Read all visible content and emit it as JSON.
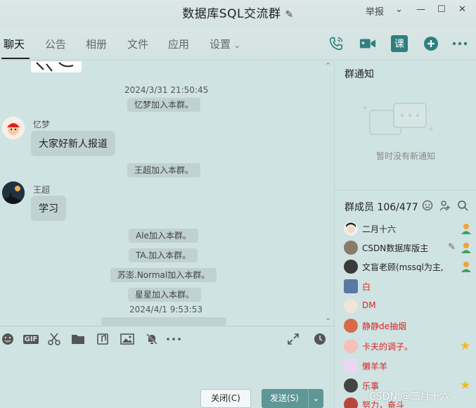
{
  "window": {
    "title": "数据库SQL交流群",
    "report": "举报",
    "controls": [
      "⌄",
      "—",
      "☐",
      "✕"
    ]
  },
  "tabs": [
    {
      "label": "聊天"
    },
    {
      "label": "公告"
    },
    {
      "label": "相册"
    },
    {
      "label": "文件"
    },
    {
      "label": "应用"
    },
    {
      "label": "设置"
    }
  ],
  "top_icons": {
    "lesson_label": "课"
  },
  "chat": {
    "messages": {
      "ts1": "2024/3/31 21:50:45",
      "join_yimeng": "忆梦加入本群。",
      "sender_yimeng": "忆梦",
      "bubble_yimeng": "大家好新人报道",
      "join_wangchao": "王超加入本群。",
      "sender_wangchao": "王超",
      "bubble_wangchao": "学习",
      "join_ale": "Ale加入本群。",
      "join_ta": "TA.加入本群。",
      "join_supeng": "苏澎.Normal加入本群。",
      "join_xingxing": "星星加入本群。",
      "ts2": "2024/4/1 9:53:53"
    }
  },
  "toolbar": {
    "gif_label": "GIF"
  },
  "buttons": {
    "close": "关闭(C)",
    "send": "发送(S)"
  },
  "notice": {
    "title": "群通知",
    "empty": "暂时没有新通知"
  },
  "members": {
    "title": "群成员 106/477",
    "list": [
      {
        "name": "二月十六",
        "red": false,
        "badge": "admin"
      },
      {
        "name": "CSDN数据库版主",
        "red": false,
        "badge": "admin"
      },
      {
        "name": "文盲老顾(mssql为主,",
        "red": false,
        "badge": "admin"
      },
      {
        "name": "白",
        "red": true,
        "badge": ""
      },
      {
        "name": "DM",
        "red": true,
        "badge": ""
      },
      {
        "name": "静静de抽烟",
        "red": true,
        "badge": ""
      },
      {
        "name": "卡夫的调子。",
        "red": true,
        "badge": "star"
      },
      {
        "name": "懒羊羊",
        "red": true,
        "badge": ""
      },
      {
        "name": "乐事",
        "red": true,
        "badge": "star"
      },
      {
        "name": "努力，奋斗",
        "red": true,
        "badge": ""
      }
    ]
  },
  "watermark": "CSDN @二月十六"
}
